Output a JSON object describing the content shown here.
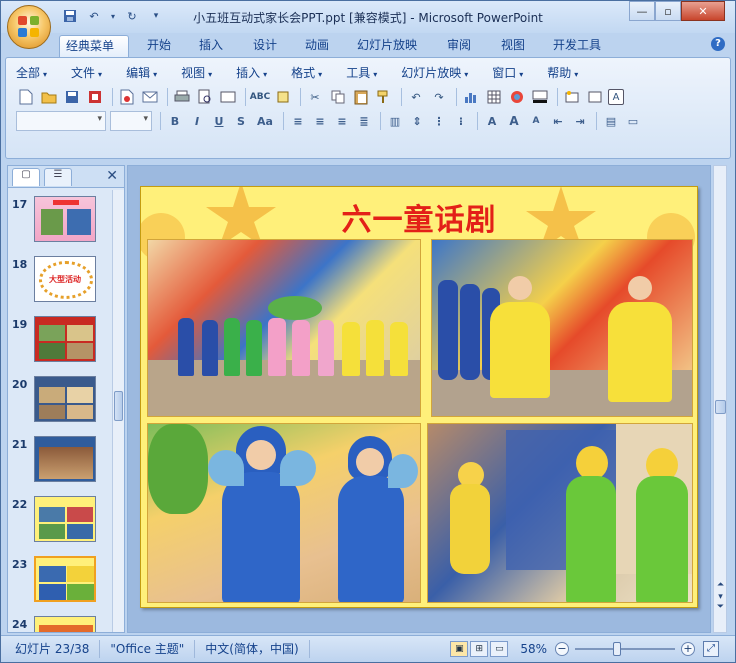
{
  "window": {
    "title": "小五班互动式家长会PPT.ppt [兼容模式] - Microsoft PowerPoint",
    "minimize_icon": "minimize-icon",
    "maximize_icon": "restore-icon",
    "close_icon": "close-icon"
  },
  "tabs": [
    "经典菜单",
    "开始",
    "插入",
    "设计",
    "动画",
    "幻灯片放映",
    "审阅",
    "视图",
    "开发工具"
  ],
  "help_label": "?",
  "menus": [
    "全部",
    "文件",
    "编辑",
    "视图",
    "插入",
    "格式",
    "工具",
    "幻灯片放映",
    "窗口",
    "帮助"
  ],
  "format_buttons": {
    "bold": "B",
    "italic": "I",
    "underline": "U",
    "strike": "S",
    "case": "Aa"
  },
  "text_color_glyph": "A",
  "panel": {
    "close": "✕"
  },
  "thumbnails": [
    {
      "num": "17",
      "label": ""
    },
    {
      "num": "18",
      "label": "大型活动"
    },
    {
      "num": "19",
      "label": ""
    },
    {
      "num": "20",
      "label": ""
    },
    {
      "num": "21",
      "label": ""
    },
    {
      "num": "22",
      "label": ""
    },
    {
      "num": "23",
      "label": ""
    },
    {
      "num": "24",
      "label": ""
    }
  ],
  "slide": {
    "title": "六一童话剧"
  },
  "status": {
    "slide_info": "幻灯片 23/38",
    "theme": "\"Office 主题\"",
    "language": "中文(简体，中国)",
    "zoom": "58%",
    "zoom_minus": "−",
    "zoom_plus": "+"
  },
  "colors": {
    "slide_bg": "#fff07a",
    "title_red": "#e32018",
    "ribbon_blue": "#15428b"
  }
}
